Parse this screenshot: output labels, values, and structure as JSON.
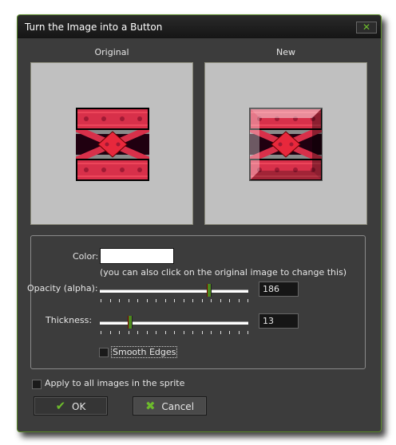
{
  "window": {
    "title": "Turn the Image into a Button",
    "close_icon": "close-x-icon"
  },
  "previews": {
    "original_label": "Original",
    "new_label": "New"
  },
  "color": {
    "label": "Color:",
    "value": "#ffffff",
    "hint": "(you can also click on the original image to change this)"
  },
  "opacity": {
    "label": "Opacity (alpha):",
    "value": "186",
    "fraction": 0.73
  },
  "thickness": {
    "label": "Thickness:",
    "value": "13",
    "fraction": 0.2
  },
  "smooth_edges": {
    "label": "Smooth Edges",
    "checked": false
  },
  "apply_all": {
    "label": "Apply to all images in the sprite",
    "checked": false
  },
  "buttons": {
    "ok": "OK",
    "cancel": "Cancel"
  },
  "colors": {
    "accent": "#4d8a1e",
    "background": "#3c3c3c"
  }
}
